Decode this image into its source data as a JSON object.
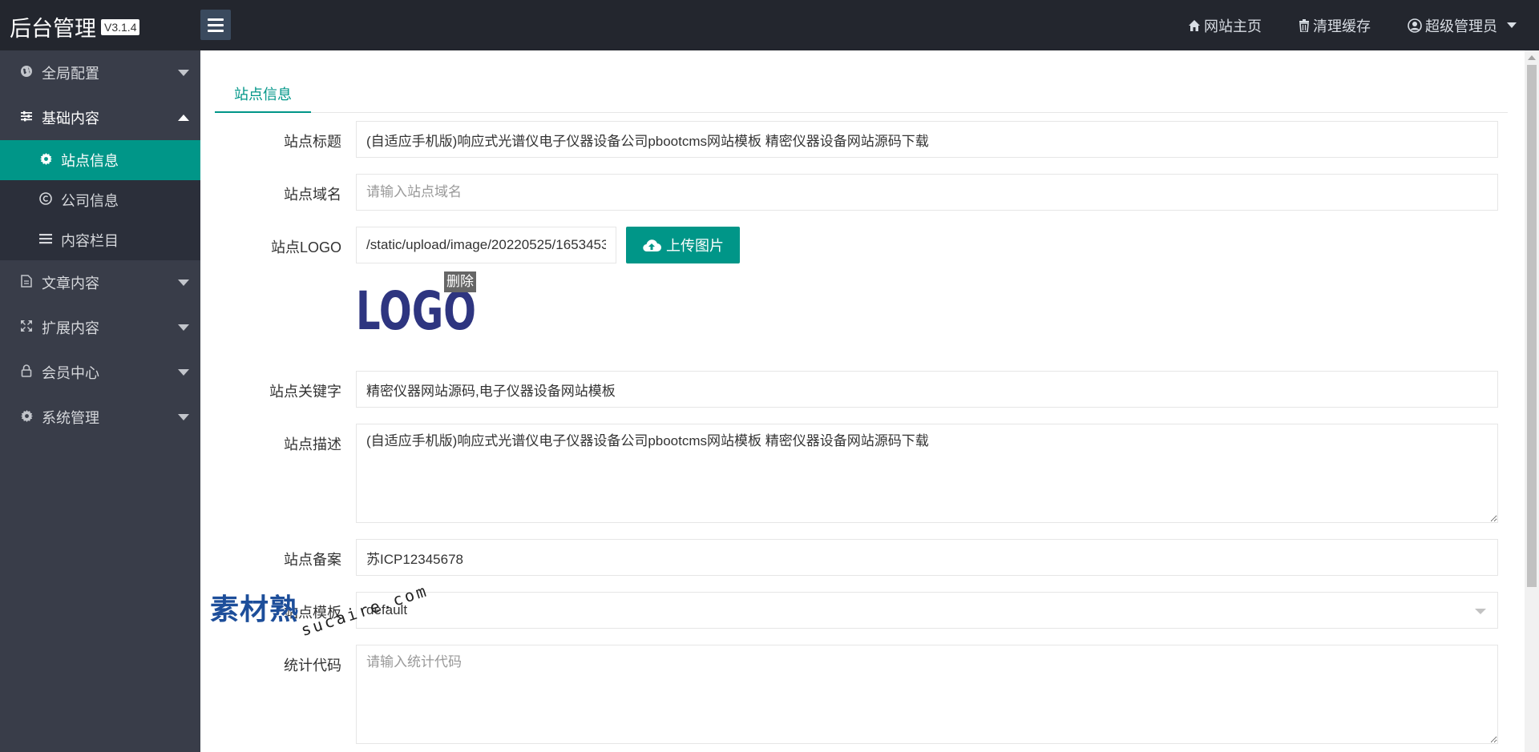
{
  "header": {
    "brand": "后台管理",
    "version": "V3.1.4",
    "links": {
      "home": "网站主页",
      "clear_cache": "清理缓存",
      "user": "超级管理员"
    }
  },
  "sidebar": {
    "global_config": "全局配置",
    "basic_content": "基础内容",
    "basic_sub": {
      "site_info": "站点信息",
      "company_info": "公司信息",
      "content_columns": "内容栏目"
    },
    "article_content": "文章内容",
    "extend_content": "扩展内容",
    "member_center": "会员中心",
    "system_manage": "系统管理"
  },
  "main": {
    "tab": "站点信息",
    "form": {
      "title": {
        "label": "站点标题",
        "value": "(自适应手机版)响应式光谱仪电子仪器设备公司pbootcms网站模板 精密仪器设备网站源码下载"
      },
      "domain": {
        "label": "站点域名",
        "placeholder": "请输入站点域名"
      },
      "logo": {
        "label": "站点LOGO",
        "value": "/static/upload/image/20220525/1653453",
        "upload_label": "上传图片",
        "delete_label": "删除",
        "preview_text": "LOGO"
      },
      "keywords": {
        "label": "站点关键字",
        "value": "精密仪器网站源码,电子仪器设备网站模板"
      },
      "description": {
        "label": "站点描述",
        "value": "(自适应手机版)响应式光谱仪电子仪器设备公司pbootcms网站模板 精密仪器设备网站源码下载"
      },
      "icp": {
        "label": "站点备案",
        "value": "苏ICP12345678"
      },
      "template": {
        "label": "站点模板",
        "value": "default"
      },
      "stats": {
        "label": "统计代码",
        "placeholder": "请输入统计代码"
      }
    }
  },
  "watermark": {
    "main": "素材熟",
    "sub": "sucaire.com"
  },
  "colors": {
    "accent": "#009688",
    "header_bg": "#23262e",
    "sidebar_bg": "#393d49",
    "logo_blue": "#2e3580"
  }
}
